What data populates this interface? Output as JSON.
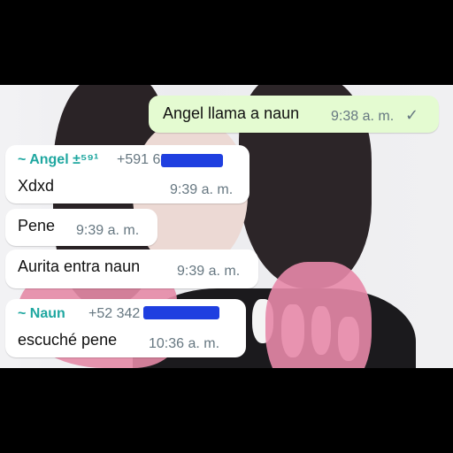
{
  "messages": [
    {
      "text": "Angel llama a naun",
      "time": "9:38 a. m.",
      "tick": "✓"
    },
    {
      "sender": "~ Angel ±⁵⁹¹",
      "phone": "+591 65  1365",
      "text": "Xdxd",
      "time": "9:39 a. m.",
      "sender_color": "#1fa7a0"
    },
    {
      "text": "Pene",
      "time": "9:39 a. m."
    },
    {
      "text": "Aurita entra naun",
      "time": "9:39 a. m."
    },
    {
      "sender": "~ Naun",
      "phone": "+52 342         4",
      "text": "escuché pene",
      "time": "10:36 a. m.",
      "sender_color": "#1fa7a0"
    }
  ]
}
